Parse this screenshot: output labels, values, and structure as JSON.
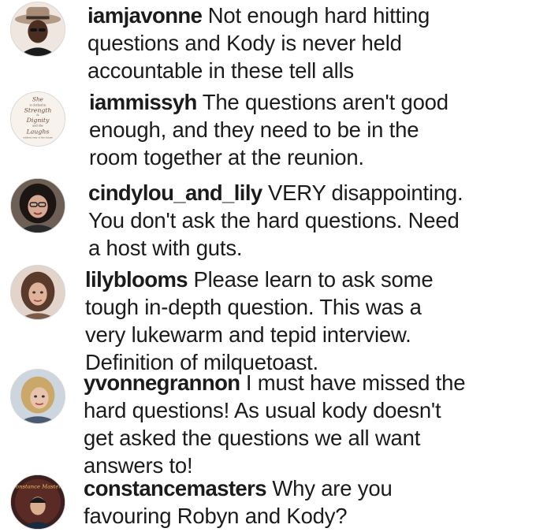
{
  "comments": [
    {
      "username": "iamjavonne",
      "lines": [
        "Not enough hard hitting",
        "questions and Kody is never held",
        "accountable in these tell alls"
      ]
    },
    {
      "username": "iammissyh",
      "lines": [
        "The questions aren't good",
        "enough, and they need to be in the",
        "room together at the reunion."
      ],
      "avatar_text": [
        "She",
        "is clothed in",
        "Strength",
        "&",
        "Dignity",
        "and she",
        "Laughs",
        "without fear of the future"
      ]
    },
    {
      "username": "cindylou_and_lily",
      "lines": [
        "VERY disappointing.",
        "You don't ask the hard questions.  Need",
        "a host with guts."
      ]
    },
    {
      "username": "lilyblooms",
      "lines": [
        "Please learn to ask some",
        "tough in-depth question. This was a",
        "very lukewarm and tepid interview.",
        "Definition of milquetoast."
      ]
    },
    {
      "username": "yvonnegrannon",
      "lines": [
        "I must have missed the",
        "hard questions! As usual kody doesn't",
        "get asked the questions we all want",
        "answers to!"
      ]
    },
    {
      "username": "constancemasters",
      "lines": [
        "Why are you",
        "favouring Robyn and Kody?"
      ],
      "avatar_text": [
        "Constance Masters"
      ]
    }
  ],
  "avatar_icons": [
    "avatar-photo-hat",
    "avatar-script-quote",
    "avatar-photo-dark-hair",
    "avatar-photo-brunette",
    "avatar-photo-blonde",
    "avatar-photo-dark-logo"
  ]
}
